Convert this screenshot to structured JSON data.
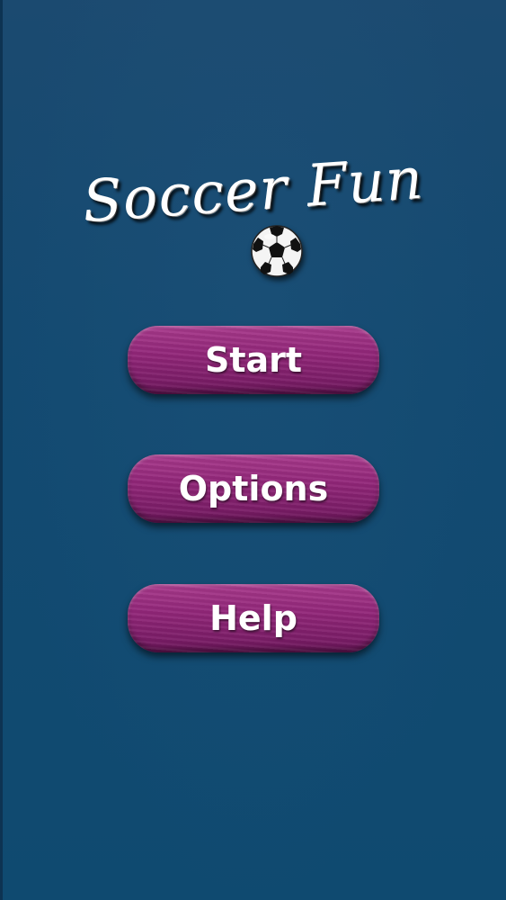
{
  "game": {
    "title": "Soccer Fun"
  },
  "menu": {
    "start_label": "Start",
    "options_label": "Options",
    "help_label": "Help"
  },
  "icons": {
    "ball": "soccer-ball-icon"
  },
  "colors": {
    "background": "#134a71",
    "button": "#93277a",
    "text": "#ffffff"
  }
}
